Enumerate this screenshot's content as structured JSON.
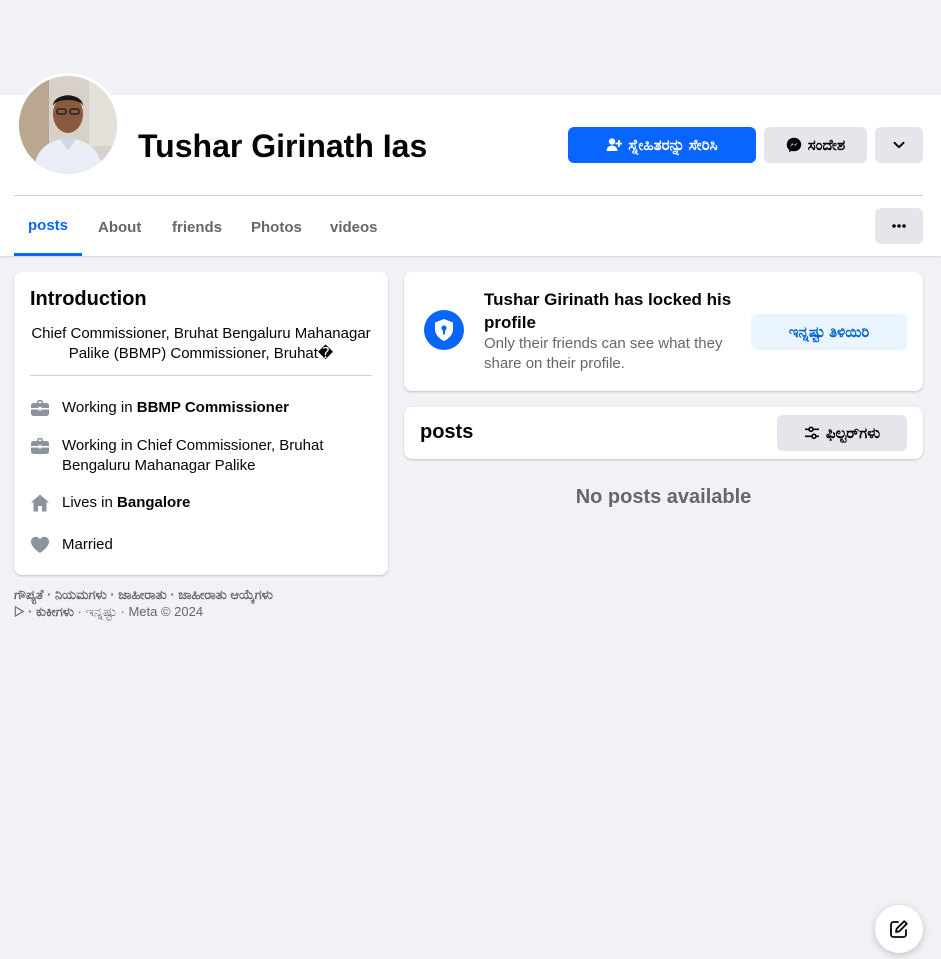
{
  "profile": {
    "name": "Tushar Girinath Ias",
    "add_friend_label": "ಸ್ನೇಹಿತರನ್ನು ಸೇರಿಸಿ",
    "message_label": "ಸಂದೇಶ"
  },
  "tabs": [
    {
      "label": "posts",
      "active": true
    },
    {
      "label": "About"
    },
    {
      "label": "friends"
    },
    {
      "label": "Photos"
    },
    {
      "label": "videos"
    }
  ],
  "intro": {
    "title": "Introduction",
    "bio": "Chief Commissioner, Bruhat Bengaluru Mahanagar Palike (BBMP) Commissioner, Bruhat�",
    "items": [
      {
        "icon": "briefcase-icon",
        "prefix": "Working in ",
        "bold": "BBMP Commissioner"
      },
      {
        "icon": "briefcase-icon",
        "prefix": "Working in Chief Commissioner, Bruhat Bengaluru Mahanagar Palike",
        "bold": ""
      },
      {
        "icon": "home-icon",
        "prefix": "Lives in ",
        "bold": "Bangalore"
      },
      {
        "icon": "heart-icon",
        "prefix": "Married",
        "bold": ""
      }
    ]
  },
  "footer": {
    "line1": "ಗೌಪ್ಯತೆ · ನಿಯಮಗಳು · ಜಾಹೀರಾತು · ಜಾಹೀರಾತು ಆಯ್ಕೆಗಳು",
    "line2_links": "▷ · ಕುಕೀಗಳು",
    "line2_rest": " · ಇನ್ನಷ್ಟು · Meta © 2024"
  },
  "locked": {
    "title": "Tushar Girinath has locked his profile",
    "subtitle": "Only their friends can see what they share on their profile.",
    "learn_more_label": "ಇನ್ನಷ್ಟು ತಿಳಿಯಿರಿ"
  },
  "posts": {
    "title": "posts",
    "filters_label": "ಫಿಲ್ಟರ್‌ಗಳು",
    "empty_text": "No posts available"
  },
  "colors": {
    "accent": "#0866ff",
    "background": "#f0f2f5",
    "secondary_text": "#65676b"
  }
}
